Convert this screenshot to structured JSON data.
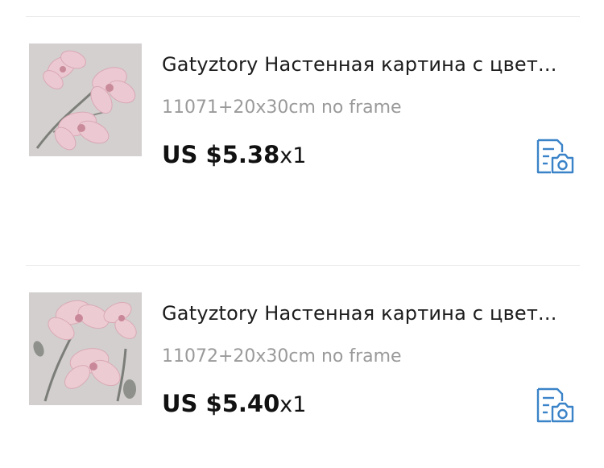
{
  "items": [
    {
      "title": "Gatyztory Настенная картина с цвет...",
      "variant": "11071+20x30cm no frame",
      "price": "US $5.38",
      "quantity": "x1",
      "thumbnail_icon": "pink-flower-painting-thumbnail",
      "action_icon": "document-camera-icon"
    },
    {
      "title": "Gatyztory Настенная картина с цвет...",
      "variant": "11072+20x30cm no frame",
      "price": "US $5.40",
      "quantity": "x1",
      "thumbnail_icon": "pink-flower-painting-thumbnail",
      "action_icon": "document-camera-icon"
    }
  ],
  "colors": {
    "accent": "#3a83c8",
    "title_text": "#1c1c1c",
    "variant_text": "#9a9a9a",
    "divider": "#ececec",
    "flower_pink": "#e9c6cf"
  }
}
